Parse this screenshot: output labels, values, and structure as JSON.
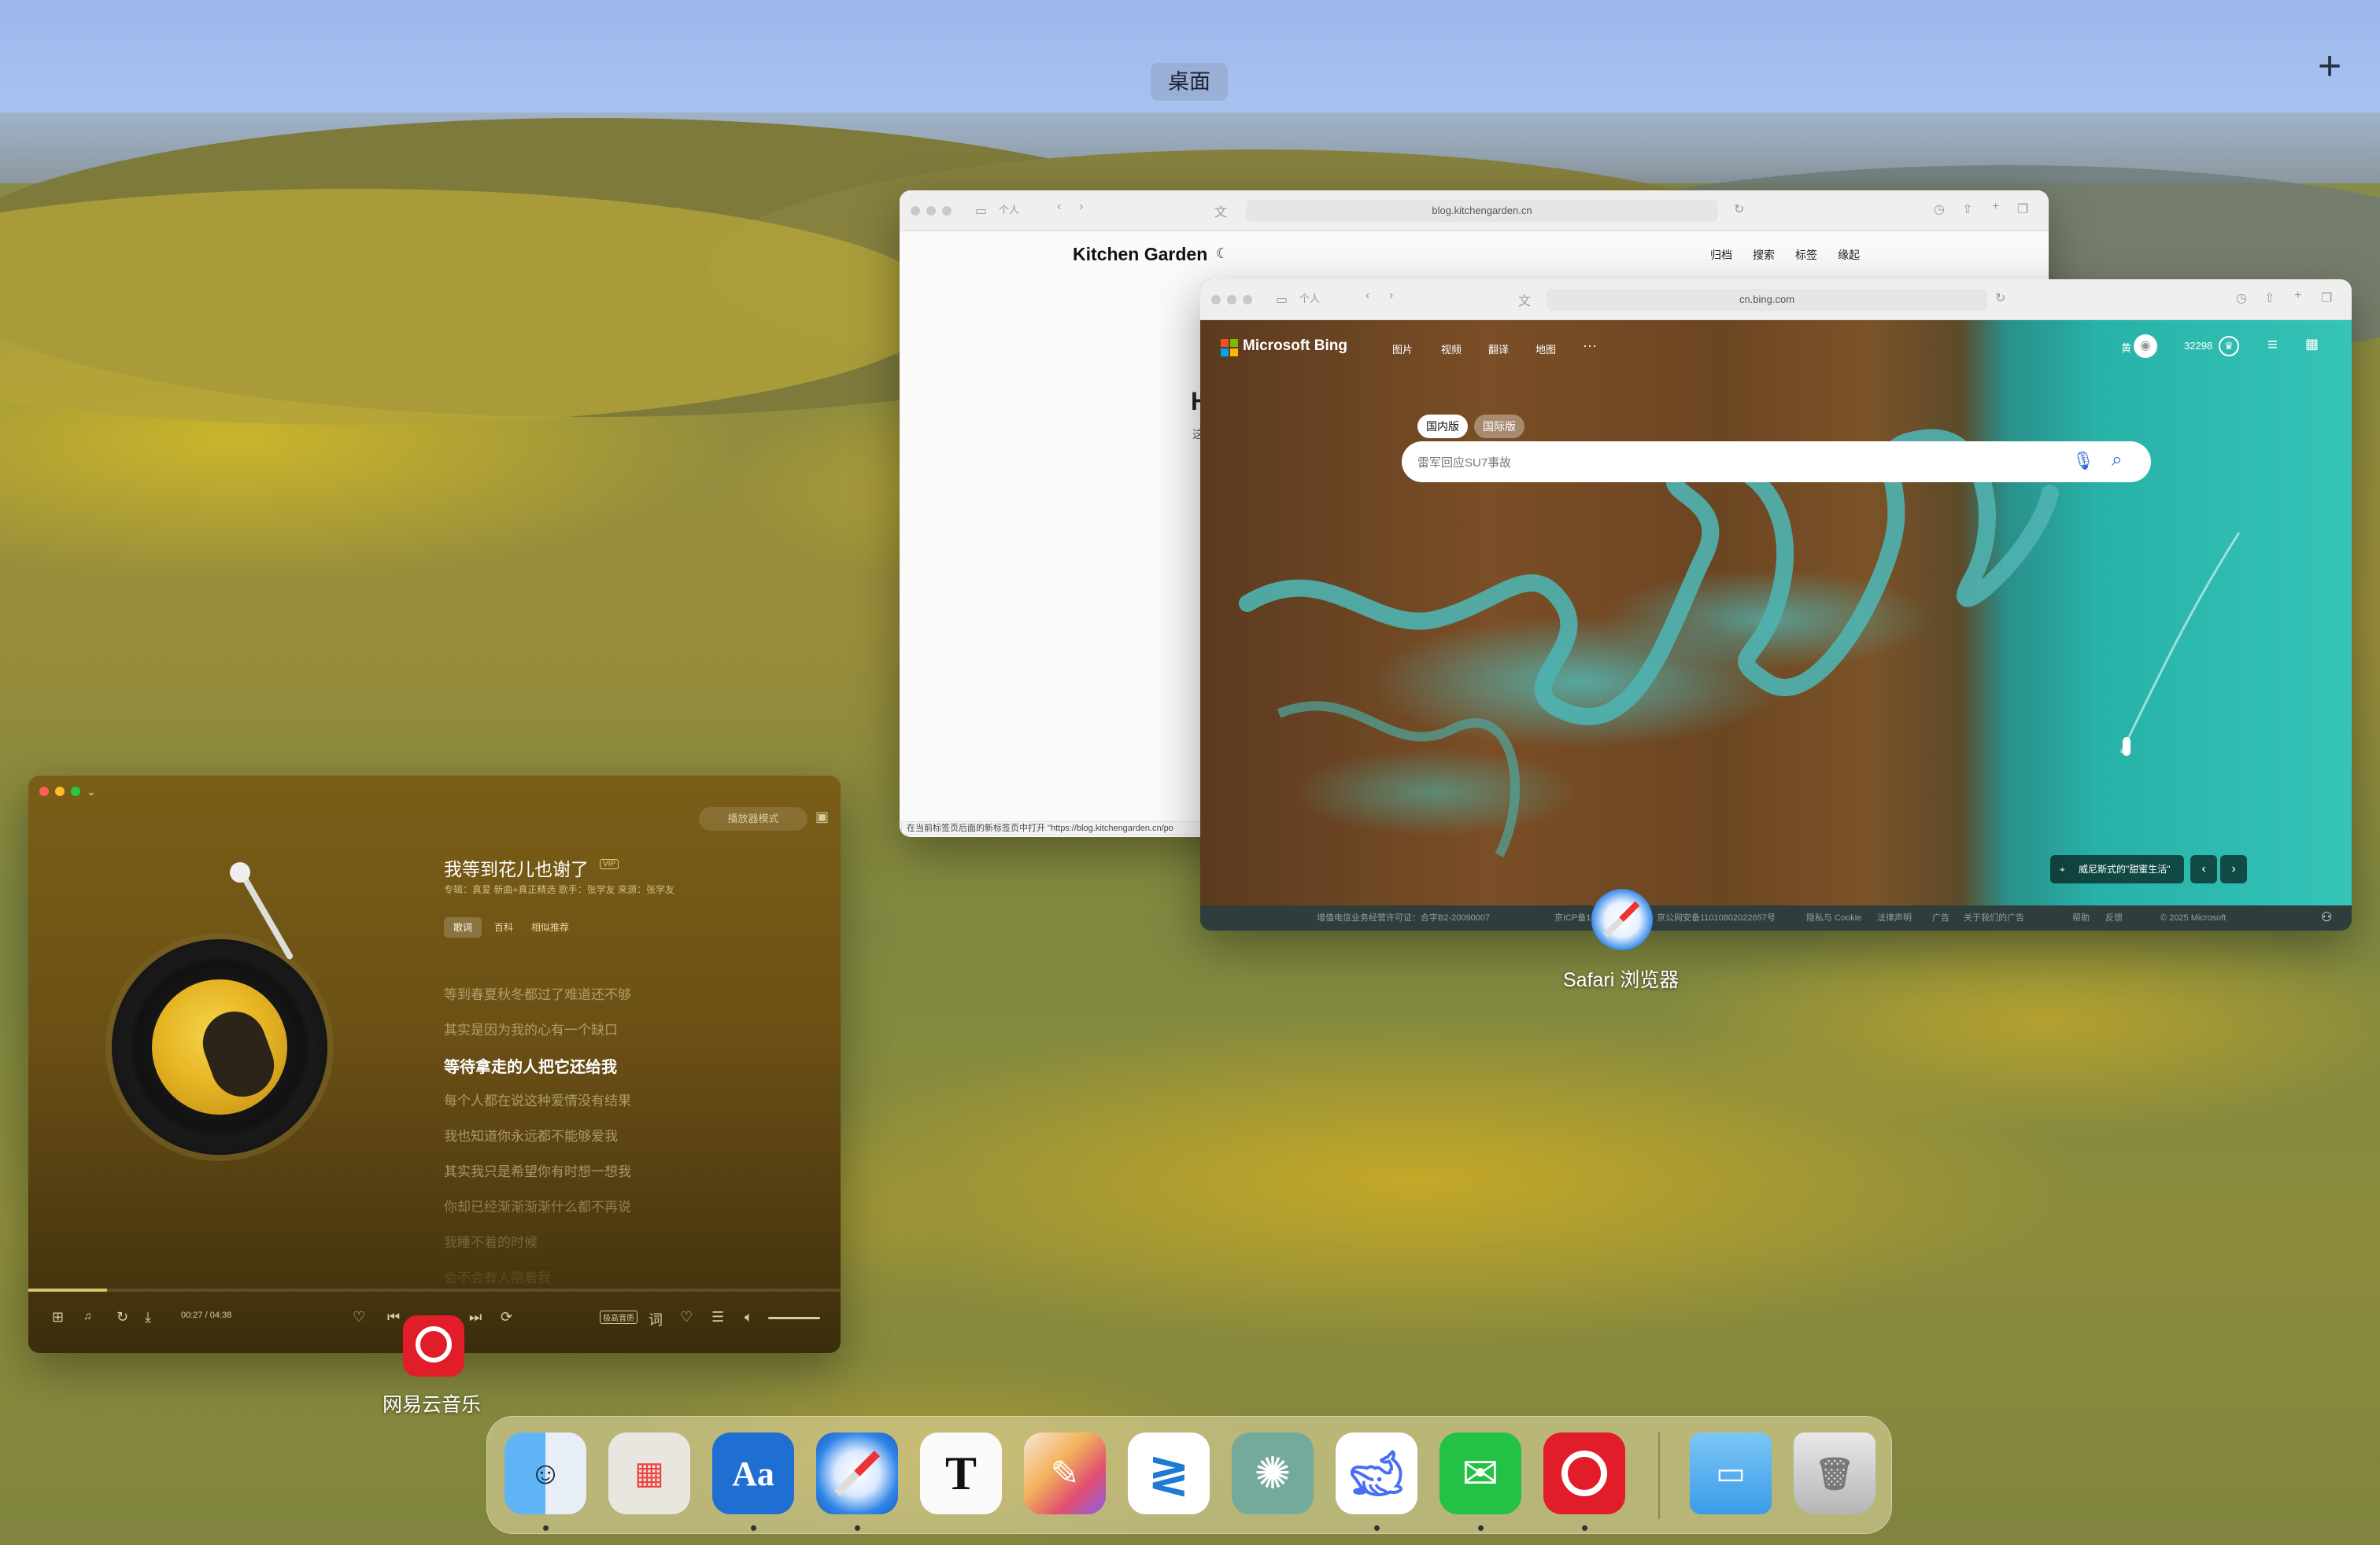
{
  "spaces": {
    "desktop_label": "桌面",
    "add_label": "+"
  },
  "kitchen_window": {
    "url": "blog.kitchengarden.cn",
    "profile": "个人",
    "site_title": "Kitchen Garden",
    "nav": [
      "归档",
      "搜索",
      "标签",
      "缘起"
    ],
    "heading_partial": "H",
    "sub_partial": "这",
    "status_text": "在当前标签页后面的新标签页中打开 \"https://blog.kitchengarden.cn/po"
  },
  "bing_window": {
    "url": "cn.bing.com",
    "profile": "个人",
    "brand": "Microsoft Bing",
    "nav": [
      "图片",
      "视频",
      "翻译",
      "地图",
      "···"
    ],
    "user_initial": "黄",
    "rewards_points": "32298",
    "tab_domestic": "国内版",
    "tab_international": "国际版",
    "search_placeholder": "雷军回应SU7事故",
    "location_caption": "威尼斯式的\"甜蜜生活\"",
    "footer": [
      "增值电信业务经营许可证：合字B2-20090007",
      "京ICP备10036305号-7",
      "京公网安备11010802022657号",
      "隐私与 Cookie",
      "法律声明",
      "广告",
      "关于我们的广告",
      "帮助",
      "反馈",
      "© 2025 Microsoft"
    ]
  },
  "safari_label": "Safari 浏览器",
  "music_window": {
    "player_mode": "播放器模式",
    "song_title": "我等到花儿也谢了",
    "vip_badge": "VIP",
    "song_meta": "专辑：真爱 新曲+真正精选    歌手：张学友    来源：张学友",
    "tabs": [
      "歌词",
      "百科",
      "相似推荐"
    ],
    "lyrics": [
      "等到春夏秋冬都过了难道还不够",
      "其实是因为我的心有一个缺口",
      "等待拿走的人把它还给我",
      "每个人都在说这种爱情没有结果",
      "我也知道你永远都不能够爱我",
      "其实我只是希望你有时想一想我",
      "你却已经渐渐渐渐什么都不再说",
      "我睡不着的时候",
      "会不会有人陪着我"
    ],
    "active_lyric_index": 2,
    "time_current": "00:27",
    "time_total": "04:38",
    "progress": 0.097,
    "quality_badge": "极高音质"
  },
  "music_label": "网易云音乐",
  "dock": {
    "apps": [
      {
        "name": "Finder",
        "icon": "finder-icon",
        "running": true
      },
      {
        "name": "Launchpad",
        "icon": "launchpad-icon",
        "running": false
      },
      {
        "name": "Dictionary",
        "icon": "dictionary-icon",
        "running": true
      },
      {
        "name": "Safari",
        "icon": "safari-icon",
        "running": true
      },
      {
        "name": "Typora",
        "icon": "typora-icon",
        "running": false
      },
      {
        "name": "Pixelmator",
        "icon": "pixelmator-icon",
        "running": false
      },
      {
        "name": "VS Code",
        "icon": "vscode-icon",
        "running": false
      },
      {
        "name": "ChatGPT",
        "icon": "chatgpt-icon",
        "running": false
      },
      {
        "name": "DeepSeek",
        "icon": "deepseek-icon",
        "running": true
      },
      {
        "name": "WeChat",
        "icon": "wechat-icon",
        "running": true
      },
      {
        "name": "NetEase Music",
        "icon": "netease-music-icon",
        "running": true
      }
    ],
    "folder_icon": "downloads-folder-icon",
    "trash_icon": "trash-icon"
  },
  "colors": {
    "bing_blue": "#2a66d9",
    "netease_red": "#e11d2a",
    "music_gold": "#d8c26a"
  }
}
